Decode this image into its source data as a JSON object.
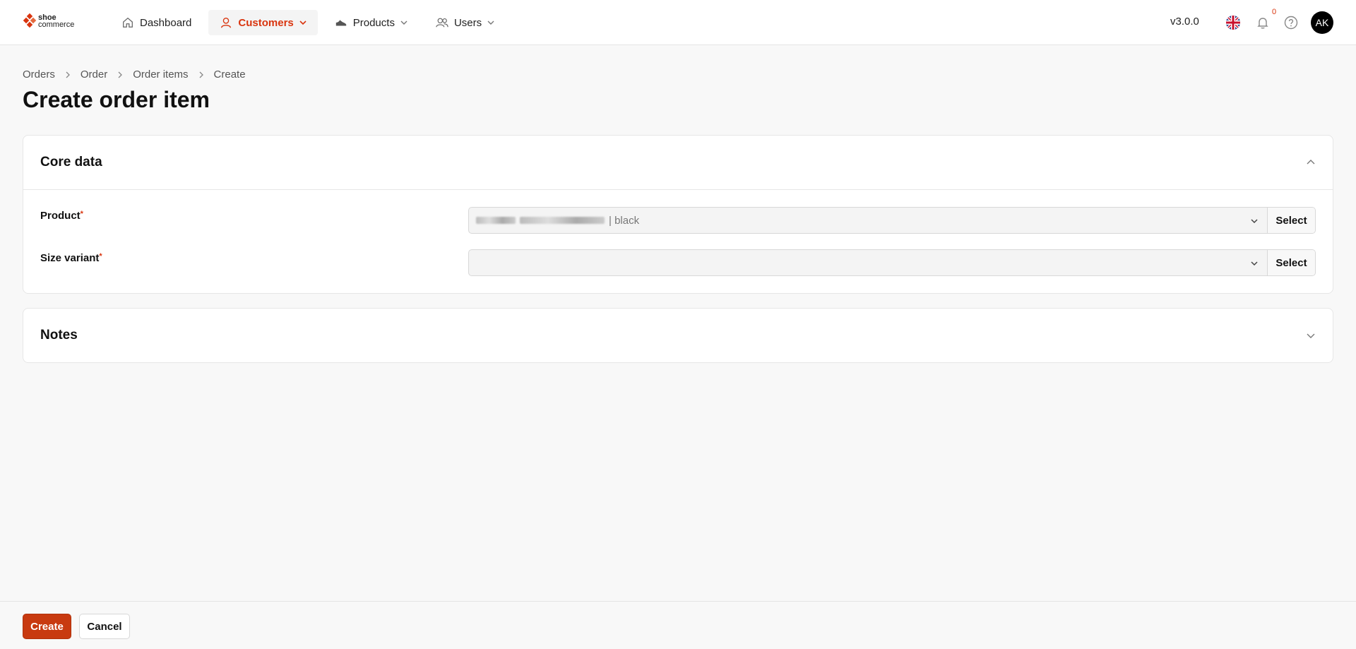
{
  "app": {
    "logo_line1": "shoe",
    "logo_line2": "commerce"
  },
  "nav": {
    "items": [
      {
        "label": "Dashboard",
        "icon": "home-icon",
        "active": false,
        "dropdown": false
      },
      {
        "label": "Customers",
        "icon": "user-icon",
        "active": true,
        "dropdown": true
      },
      {
        "label": "Products",
        "icon": "shoe-icon",
        "active": false,
        "dropdown": true
      },
      {
        "label": "Users",
        "icon": "users-icon",
        "active": false,
        "dropdown": true
      }
    ],
    "version": "v3.0.0",
    "notification_count": "0",
    "avatar_initials": "AK"
  },
  "breadcrumb": [
    "Orders",
    "Order",
    "Order items",
    "Create"
  ],
  "page_title": "Create order item",
  "core_panel": {
    "title": "Core data",
    "fields": [
      {
        "label": "Product",
        "value_suffix": "| black",
        "select_label": "Select"
      },
      {
        "label": "Size variant",
        "value_suffix": "",
        "select_label": "Select"
      }
    ]
  },
  "notes_panel": {
    "title": "Notes"
  },
  "footer": {
    "create_label": "Create",
    "cancel_label": "Cancel"
  },
  "colors": {
    "accent": "#d9350f",
    "primary_button": "#c83a10"
  }
}
